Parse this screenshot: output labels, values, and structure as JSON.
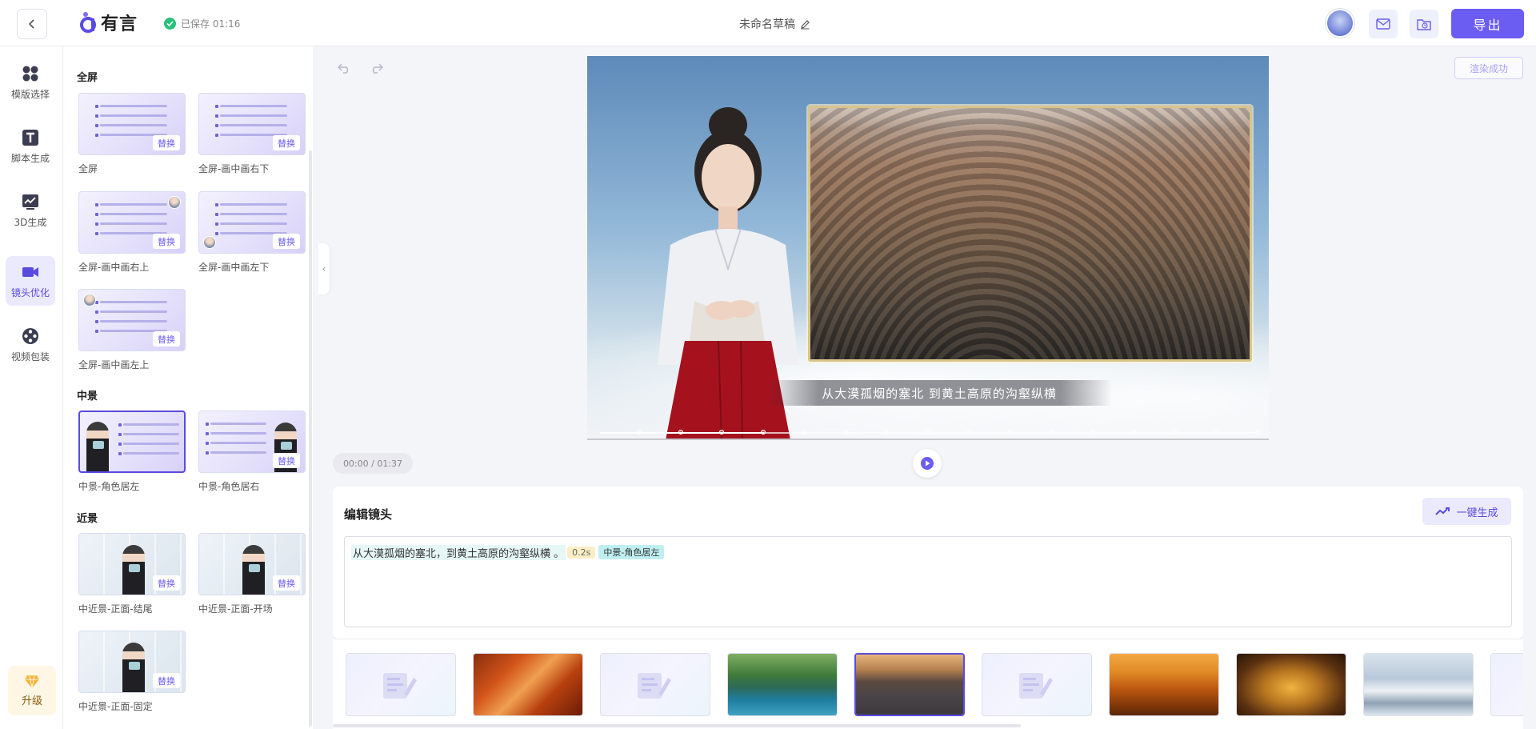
{
  "header": {
    "brand": "有言",
    "saved_status": "已保存 01:16",
    "draft_title": "未命名草稿",
    "export_label": "导出"
  },
  "rail": {
    "items": [
      {
        "label": "模版选择",
        "icon": "grid-icon"
      },
      {
        "label": "脚本生成",
        "icon": "text-icon"
      },
      {
        "label": "3D生成",
        "icon": "chart-icon"
      },
      {
        "label": "镜头优化",
        "icon": "camera-icon",
        "active": true
      },
      {
        "label": "视频包装",
        "icon": "film-reel-icon"
      }
    ],
    "upgrade_label": "升级"
  },
  "panel": {
    "sections": [
      {
        "title": "全屏",
        "cards": [
          {
            "label": "全屏",
            "replace": "替换"
          },
          {
            "label": "全屏-画中画右下",
            "replace": "替换"
          },
          {
            "label": "全屏-画中画右上",
            "replace": "替换"
          },
          {
            "label": "全屏-画中画左下",
            "replace": "替换"
          },
          {
            "label": "全屏-画中画左上",
            "replace": "替换"
          }
        ]
      },
      {
        "title": "中景",
        "cards": [
          {
            "label": "中景-角色居左",
            "selected": true
          },
          {
            "label": "中景-角色居右",
            "replace": "替换"
          }
        ]
      },
      {
        "title": "近景",
        "cards": [
          {
            "label": "中近景-正面-结尾",
            "replace": "替换"
          },
          {
            "label": "中近景-正面-开场",
            "replace": "替换"
          },
          {
            "label": "中近景-正面-固定",
            "replace": "替换"
          }
        ]
      }
    ]
  },
  "stage": {
    "render_status": "渲染成功",
    "subtitle": "从大漠孤烟的塞北 到黄土高原的沟壑纵横",
    "time": "00:00 / 01:37",
    "progress": 0.25
  },
  "edit": {
    "title": "编辑镜头",
    "generate_label": "一键生成",
    "script_text": "从大漠孤烟的塞北，到黄土高原的沟壑纵横 。",
    "pause_tag": "0.2s",
    "shot_tag": "中景-角色居左"
  },
  "clips": [
    {
      "type": "text"
    },
    {
      "type": "photo",
      "theme": "food"
    },
    {
      "type": "text"
    },
    {
      "type": "photo",
      "theme": "river"
    },
    {
      "type": "photo",
      "theme": "road",
      "selected": true
    },
    {
      "type": "text"
    },
    {
      "type": "photo",
      "theme": "desert"
    },
    {
      "type": "photo",
      "theme": "buddha"
    },
    {
      "type": "photo",
      "theme": "snow"
    },
    {
      "type": "text"
    }
  ],
  "colors": {
    "accent": "#6b5cf2",
    "accent_light": "#ebe9fc",
    "saved_green": "#27c27a"
  }
}
